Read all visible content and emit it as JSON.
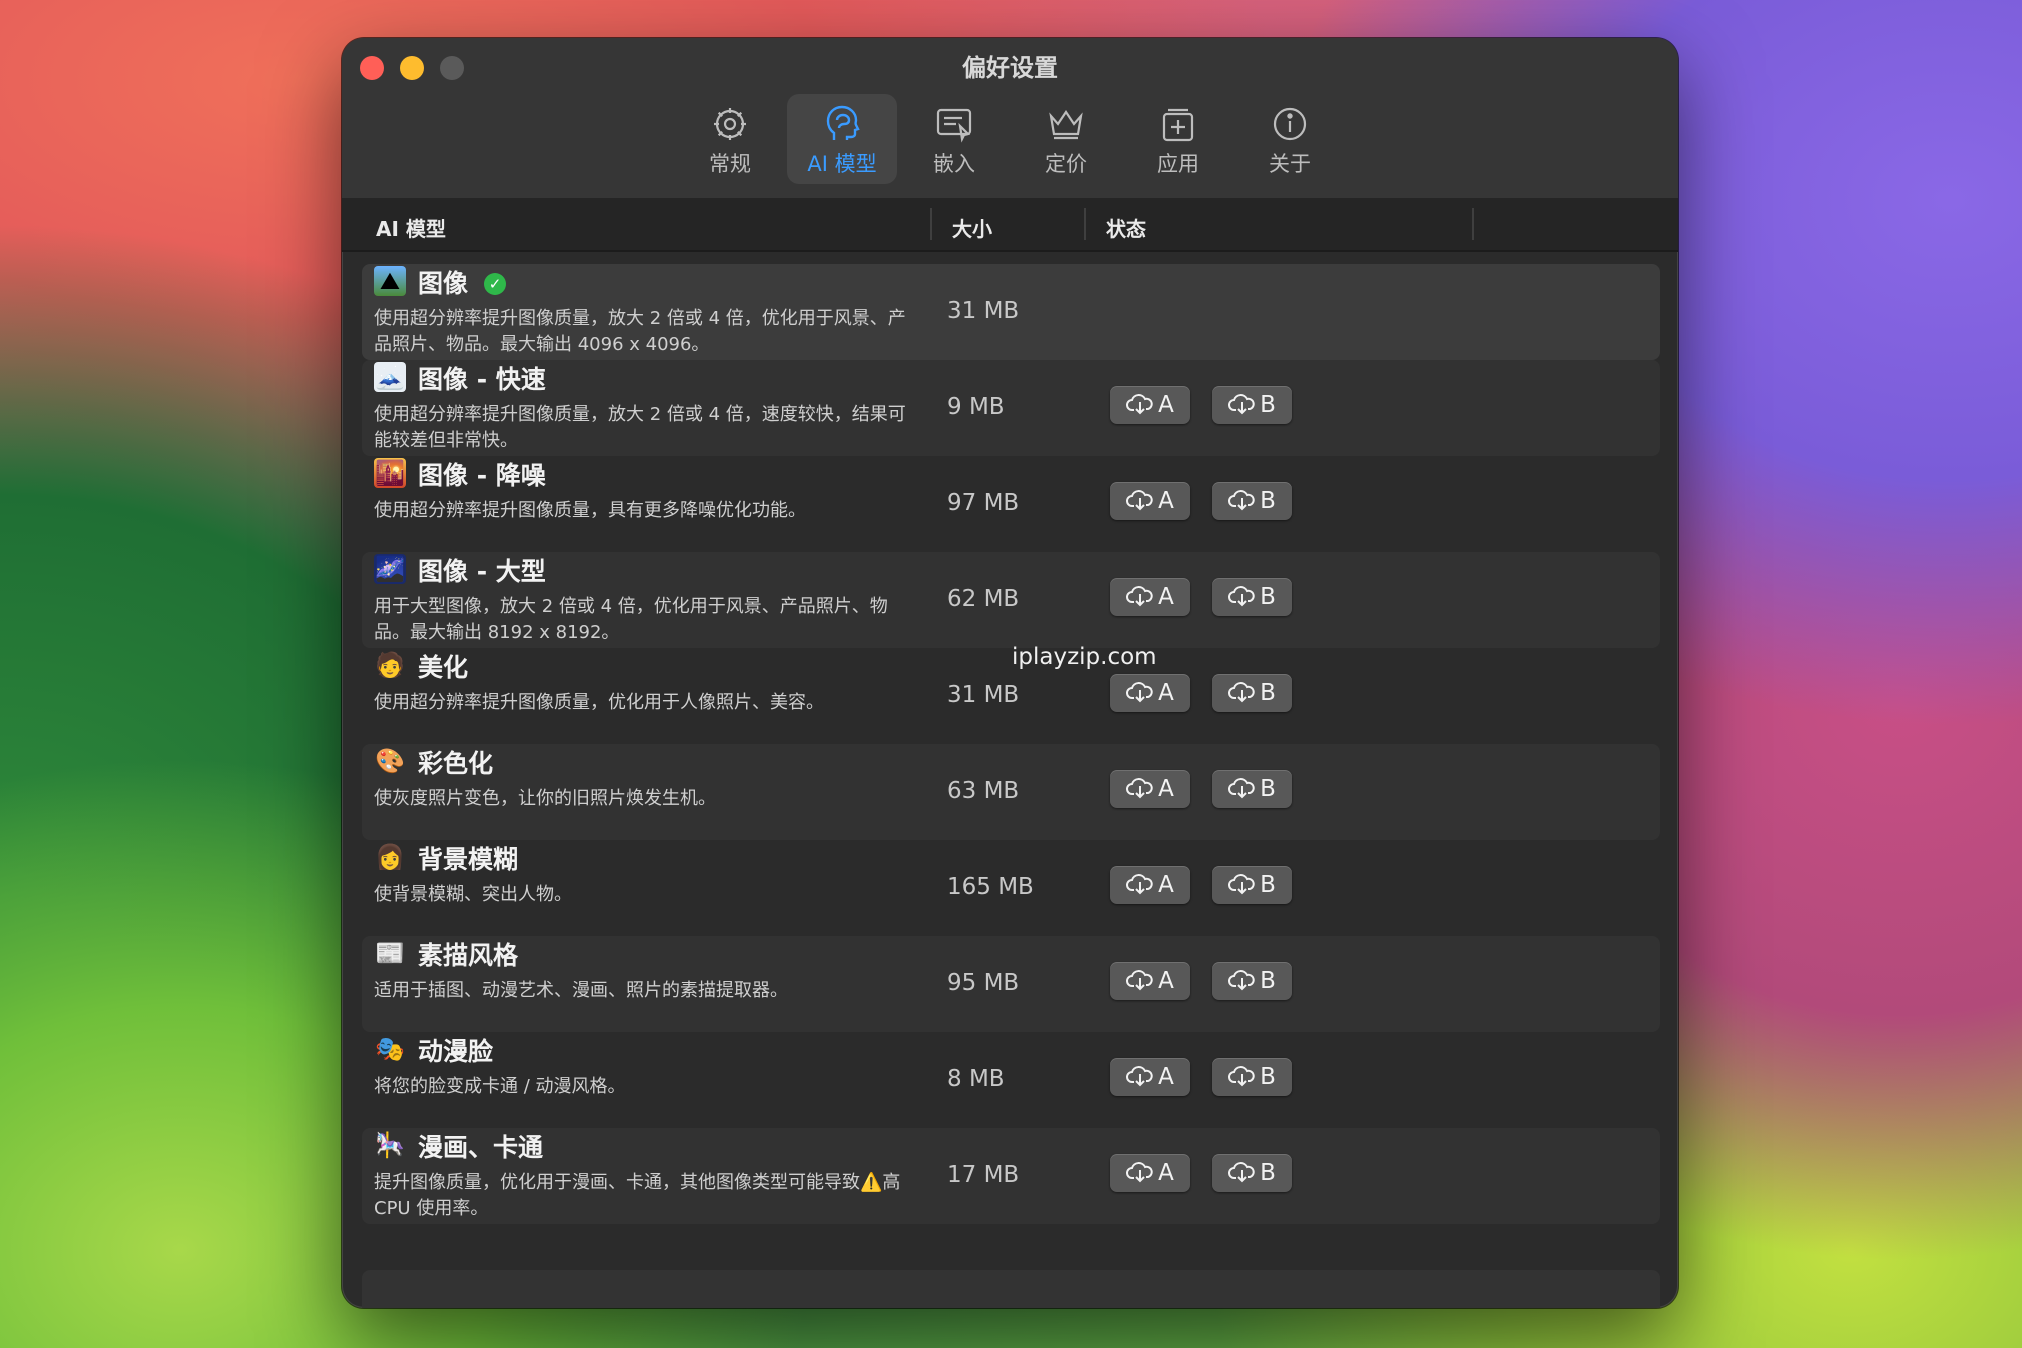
{
  "window": {
    "title": "偏好设置"
  },
  "toolbar": {
    "items": [
      {
        "label": "常规",
        "icon": "gear-icon"
      },
      {
        "label": "AI 模型",
        "icon": "brain-head-icon"
      },
      {
        "label": "嵌入",
        "icon": "embed-icon"
      },
      {
        "label": "定价",
        "icon": "crown-icon"
      },
      {
        "label": "应用",
        "icon": "app-icon"
      },
      {
        "label": "关于",
        "icon": "info-icon"
      }
    ],
    "active": "AI 模型"
  },
  "table": {
    "headers": {
      "model": "AI 模型",
      "size": "大小",
      "status": "状态"
    },
    "download_a_label": "A",
    "download_b_label": "B",
    "rows": [
      {
        "name": "图像",
        "desc": "使用超分辨率提升图像质量，放大 2 倍或 4 倍，优化用于风景、产品照片、物品。最大输出 4096 x 4096。",
        "size": "31 MB",
        "icon": "landscape-icon",
        "installed": true
      },
      {
        "name": "图像 - 快速",
        "desc": "使用超分辨率提升图像质量，放大 2 倍或 4 倍，速度较快，结果可能较差但非常快。",
        "size": "9 MB",
        "icon": "mountain-photo-icon"
      },
      {
        "name": "图像 - 降噪",
        "desc": "使用超分辨率提升图像质量，具有更多降噪优化功能。",
        "size": "97 MB",
        "icon": "city-sunset-icon"
      },
      {
        "name": "图像 - 大型",
        "desc": "用于大型图像，放大 2 倍或 4 倍，优化用于风景、产品照片、物品。最大输出 8192 x 8192。",
        "size": "62 MB",
        "icon": "night-sky-icon"
      },
      {
        "name": "美化",
        "desc": "使用超分辨率提升图像质量，优化用于人像照片、美容。",
        "size": "31 MB",
        "icon": "person-icon"
      },
      {
        "name": "彩色化",
        "desc": "使灰度照片变色，让你的旧照片焕发生机。",
        "size": "63 MB",
        "icon": "palette-icon"
      },
      {
        "name": "背景模糊",
        "desc": "使背景模糊、突出人物。",
        "size": "165 MB",
        "icon": "portrait-icon"
      },
      {
        "name": "素描风格",
        "desc": "适用于插图、动漫艺术、漫画、照片的素描提取器。",
        "size": "95 MB",
        "icon": "newspaper-icon"
      },
      {
        "name": "动漫脸",
        "desc": "将您的脸变成卡通 / 动漫风格。",
        "size": "8 MB",
        "icon": "masks-icon"
      },
      {
        "name": "漫画、卡通",
        "desc": "提升图像质量，优化用于漫画、卡通，其他图像类型可能导致⚠️高 CPU 使用率。",
        "size": "17 MB",
        "icon": "carousel-horse-icon"
      }
    ]
  },
  "watermark": "iplayzip.com"
}
